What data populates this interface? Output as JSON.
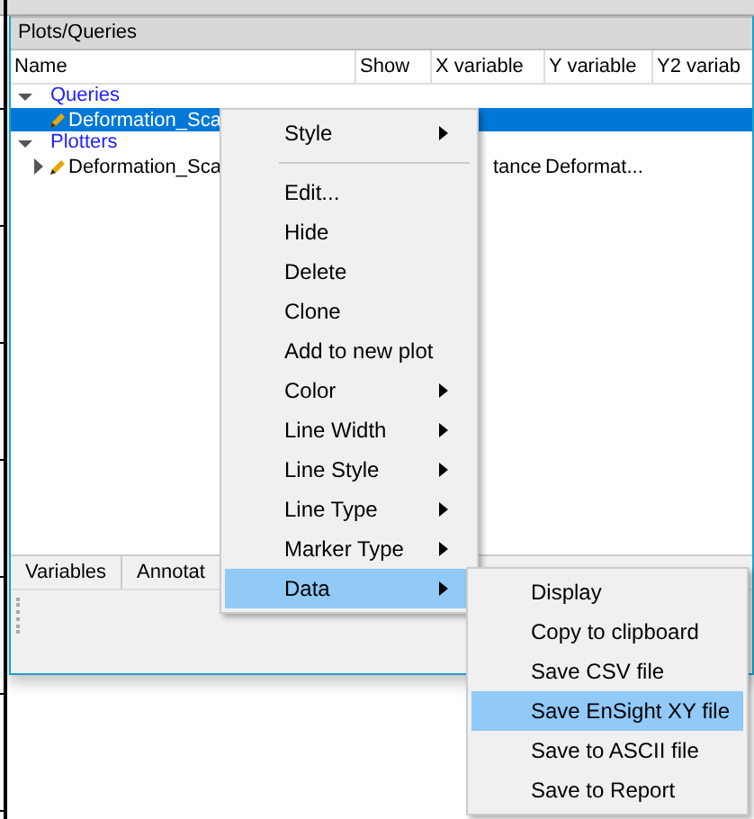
{
  "panel": {
    "title": "Plots/Queries"
  },
  "columns": [
    "Name",
    "Show",
    "X variable",
    "Y variable",
    "Y2 variab"
  ],
  "tree": [
    {
      "label": "Queries",
      "expanded": true,
      "children": [
        {
          "name": "Deformation_Sca",
          "selected": true,
          "cells": [
            "",
            "",
            ""
          ]
        }
      ]
    },
    {
      "label": "Plotters",
      "expanded": true,
      "children": [
        {
          "name": "Deformation_Sca",
          "selected": false,
          "expanded": false,
          "cells": [
            "tance",
            "Deformat...",
            ""
          ]
        }
      ]
    }
  ],
  "tabs": [
    "Variables",
    "Annotat"
  ],
  "context_menu": [
    {
      "kind": "item",
      "label": "Style",
      "submenu": true,
      "selected": false
    },
    {
      "kind": "separator"
    },
    {
      "kind": "item",
      "label": "Edit...",
      "submenu": false,
      "selected": false
    },
    {
      "kind": "item",
      "label": "Hide",
      "submenu": false,
      "selected": false
    },
    {
      "kind": "item",
      "label": "Delete",
      "submenu": false,
      "selected": false
    },
    {
      "kind": "item",
      "label": "Clone",
      "submenu": false,
      "selected": false
    },
    {
      "kind": "item",
      "label": "Add to new plot",
      "submenu": false,
      "selected": false
    },
    {
      "kind": "item",
      "label": "Color",
      "submenu": true,
      "selected": false
    },
    {
      "kind": "item",
      "label": "Line Width",
      "submenu": true,
      "selected": false
    },
    {
      "kind": "item",
      "label": "Line Style",
      "submenu": true,
      "selected": false
    },
    {
      "kind": "item",
      "label": "Line Type",
      "submenu": true,
      "selected": false
    },
    {
      "kind": "item",
      "label": "Marker Type",
      "submenu": true,
      "selected": false
    },
    {
      "kind": "item",
      "label": "Data",
      "submenu": true,
      "selected": true
    }
  ],
  "submenu": [
    {
      "label": "Display",
      "selected": false
    },
    {
      "label": "Copy to clipboard",
      "selected": false
    },
    {
      "label": "Save CSV file",
      "selected": false
    },
    {
      "label": "Save EnSight XY file",
      "selected": true
    },
    {
      "label": "Save to ASCII file",
      "selected": false
    },
    {
      "label": "Save to Report",
      "selected": false
    }
  ]
}
